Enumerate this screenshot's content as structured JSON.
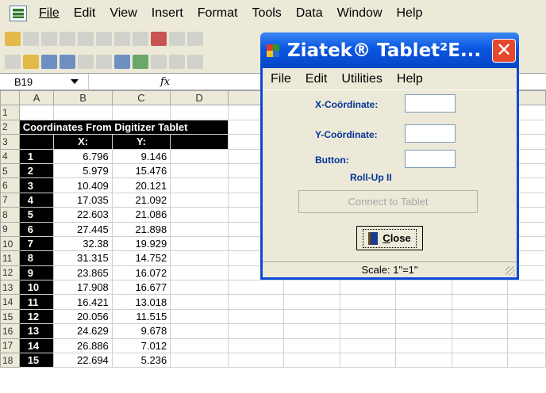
{
  "excel": {
    "menu": [
      "File",
      "Edit",
      "View",
      "Insert",
      "Format",
      "Tools",
      "Data",
      "Window",
      "Help"
    ],
    "name_box": "B19",
    "fx_label": "fx",
    "columns": [
      "A",
      "B",
      "C",
      "D"
    ],
    "title": "Coordinates From Digitizer Tablet",
    "x_header": "X:",
    "y_header": "Y:",
    "row_numbers": [
      "1",
      "2",
      "3",
      "4",
      "5",
      "6",
      "7",
      "8",
      "9",
      "10",
      "11",
      "12",
      "13",
      "14",
      "15",
      "16",
      "17",
      "18"
    ],
    "rows": [
      {
        "n": "1",
        "x": "6.796",
        "y": "9.146"
      },
      {
        "n": "2",
        "x": "5.979",
        "y": "15.476"
      },
      {
        "n": "3",
        "x": "10.409",
        "y": "20.121"
      },
      {
        "n": "4",
        "x": "17.035",
        "y": "21.092"
      },
      {
        "n": "5",
        "x": "22.603",
        "y": "21.086"
      },
      {
        "n": "6",
        "x": "27.445",
        "y": "21.898"
      },
      {
        "n": "7",
        "x": "32.38",
        "y": "19.929"
      },
      {
        "n": "8",
        "x": "31.315",
        "y": "14.752"
      },
      {
        "n": "9",
        "x": "23.865",
        "y": "16.072"
      },
      {
        "n": "10",
        "x": "17.908",
        "y": "16.677"
      },
      {
        "n": "11",
        "x": "16.421",
        "y": "13.018"
      },
      {
        "n": "12",
        "x": "20.056",
        "y": "11.515"
      },
      {
        "n": "13",
        "x": "24.629",
        "y": "9.678"
      },
      {
        "n": "14",
        "x": "26.886",
        "y": "7.012"
      },
      {
        "n": "15",
        "x": "22.694",
        "y": "5.236"
      }
    ]
  },
  "dialog": {
    "title": "Ziatek® Tablet²E...",
    "close_glyph": "✕",
    "menu": [
      "File",
      "Edit",
      "Utilities",
      "Help"
    ],
    "x_label": "X-Coördinate:",
    "y_label": "Y-Coördinate:",
    "button_label": "Button:",
    "x_value": "",
    "y_value": "",
    "button_value": "",
    "model": "Roll-Up II",
    "connect_label": "Connect to Tablet",
    "close_label": "Close",
    "close_accel": "C",
    "close_rest": "lose",
    "status": "Scale: 1\"=1\""
  },
  "colors": {
    "titlebar": "#0a56e0",
    "close_red": "#e5492d",
    "label_blue": "#003399",
    "header_black": "#000000"
  }
}
